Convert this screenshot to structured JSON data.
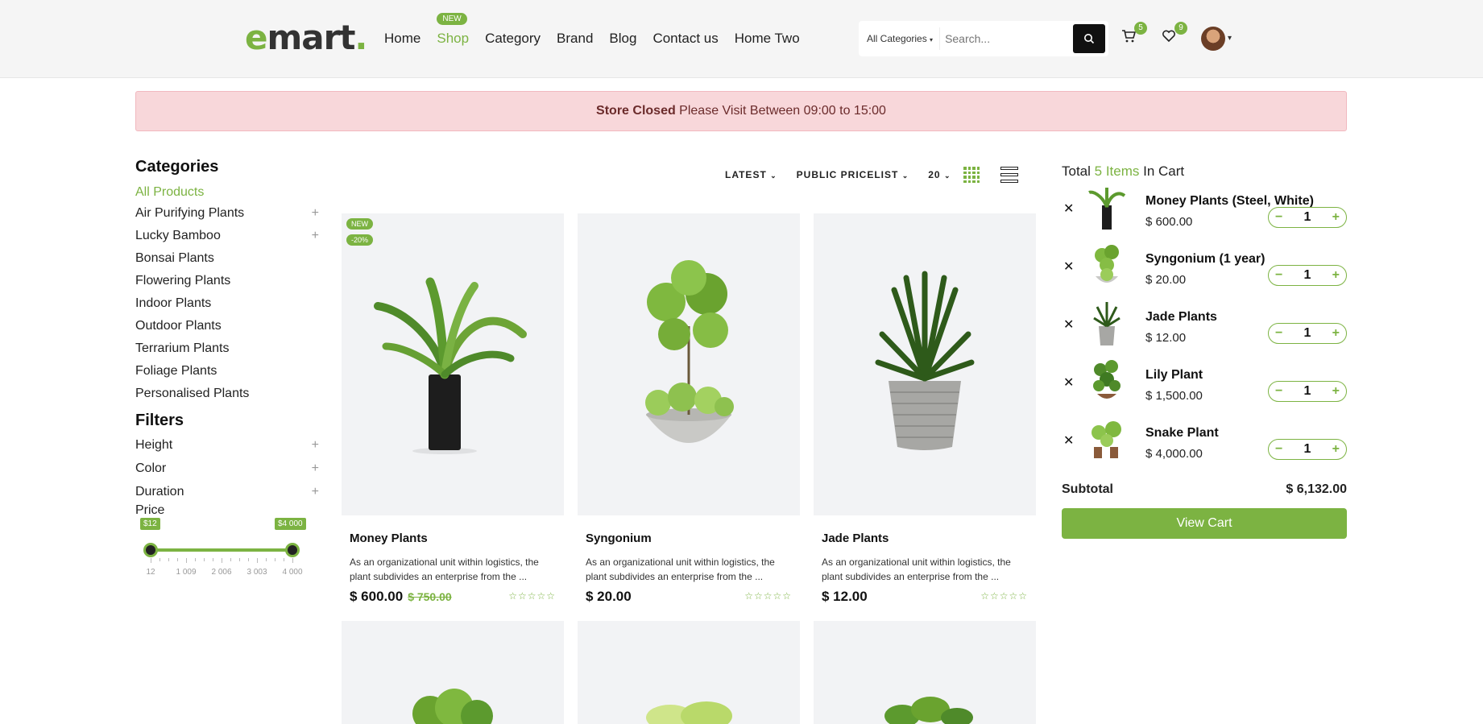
{
  "header": {
    "logo_prefix": "e",
    "logo_main": "mart",
    "logo_dot": ".",
    "nav": [
      {
        "label": "Home"
      },
      {
        "label": "Shop",
        "tag": "NEW"
      },
      {
        "label": "Category"
      },
      {
        "label": "Brand"
      },
      {
        "label": "Blog"
      },
      {
        "label": "Contact us"
      },
      {
        "label": "Home Two"
      }
    ],
    "search_category": "All Categories",
    "search_placeholder": "Search...",
    "cart_count": "5",
    "wishlist_count": "9"
  },
  "alert": {
    "strong": "Store Closed",
    "text": " Please Visit Between 09:00 to 15:00"
  },
  "sidebar": {
    "categories_title": "Categories",
    "all_products": "All Products",
    "categories": [
      "Air Purifying Plants",
      "Lucky Bamboo",
      "Bonsai Plants",
      "Flowering Plants",
      "Indoor Plants",
      "Outdoor Plants",
      "Terrarium Plants",
      "Foliage Plants",
      "Personalised Plants"
    ],
    "filters_title": "Filters",
    "filters": [
      "Height",
      "Color",
      "Duration"
    ],
    "price_title": "Price",
    "price_min_flag": "$12",
    "price_max_flag": "$4 000",
    "tick_labels": [
      "12",
      "1 009",
      "2 006",
      "3 003",
      "4 000"
    ]
  },
  "toolbar": {
    "sort": "LATEST",
    "pricelist": "PUBLIC PRICELIST",
    "per_page": "20"
  },
  "products": [
    {
      "name": "Money Plants",
      "desc": "As an organizational unit within logistics, the plant subdivides an enterprise from the ...",
      "price": "$ 600.00",
      "old_price": "$ 750.00",
      "tags": [
        "NEW",
        "-20%"
      ],
      "stars": "☆☆☆☆☆"
    },
    {
      "name": "Syngonium",
      "desc": "As an organizational unit within logistics, the plant subdivides an enterprise from the ...",
      "price": "$ 20.00",
      "old_price": "",
      "tags": [],
      "stars": "☆☆☆☆☆"
    },
    {
      "name": "Jade Plants",
      "desc": "As an organizational unit within logistics, the plant subdivides an enterprise from the ...",
      "price": "$ 12.00",
      "old_price": "",
      "tags": [],
      "stars": "☆☆☆☆☆"
    }
  ],
  "cart": {
    "total_prefix": "Total ",
    "total_items": "5 Items",
    "total_suffix": " In Cart",
    "items": [
      {
        "name": "Money Plants (Steel, White)",
        "price": "$ 600.00",
        "qty": "1"
      },
      {
        "name": "Syngonium (1 year)",
        "price": "$ 20.00",
        "qty": "1"
      },
      {
        "name": "Jade Plants",
        "price": "$ 12.00",
        "qty": "1"
      },
      {
        "name": "Lily Plant",
        "price": "$ 1,500.00",
        "qty": "1"
      },
      {
        "name": "Snake Plant",
        "price": "$ 4,000.00",
        "qty": "1"
      }
    ],
    "subtotal_label": "Subtotal",
    "subtotal_value": "$ 6,132.00",
    "view_cart": "View Cart"
  }
}
